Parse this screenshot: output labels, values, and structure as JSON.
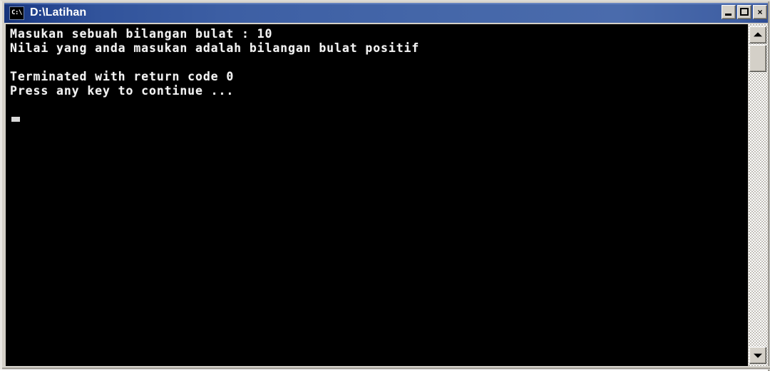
{
  "window": {
    "title": "D:\\Latihan",
    "icon_label": "C:\\",
    "icon_name": "console-icon"
  },
  "caption_buttons": {
    "minimize": {
      "label": "",
      "name": "minimize-button"
    },
    "maximize": {
      "label": "",
      "name": "maximize-button"
    },
    "close": {
      "label": "×",
      "name": "close-button"
    }
  },
  "console": {
    "lines": [
      "Masukan sebuah bilangan bulat : 10",
      "Nilai yang anda masukan adalah bilangan bulat positif",
      "",
      "Terminated with return code 0",
      "Press any key to continue ...",
      "",
      ""
    ],
    "text": "Masukan sebuah bilangan bulat : 10\nNilai yang anda masukan adalah bilangan bulat positif\n\nTerminated with return code 0\nPress any key to continue ...",
    "input_value": "10",
    "return_code": "0",
    "background_color": "#000000",
    "foreground_color": "#f2f2f2"
  },
  "scrollbar": {
    "up_arrow": "▲",
    "down_arrow": "▼"
  },
  "colors": {
    "titlebar_start": "#16337a",
    "titlebar_end": "#4a6bac",
    "frame": "#d4d0c8"
  }
}
